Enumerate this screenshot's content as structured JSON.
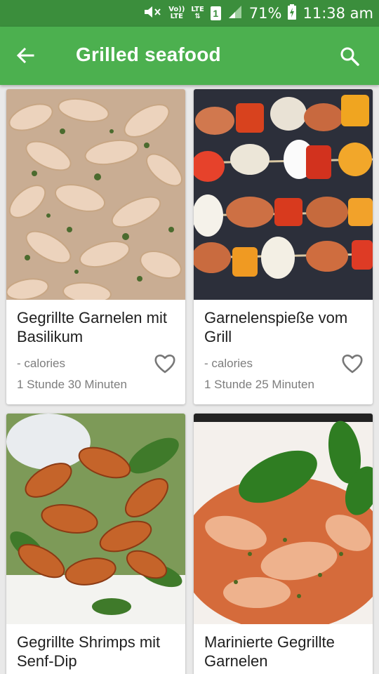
{
  "status_bar": {
    "volte_top": "Vo))",
    "volte_bottom": "LTE",
    "lte_top": "LTE",
    "lte_bottom": "⇅",
    "sim_number": "1",
    "battery_percent": "71%",
    "time": "11:38 am",
    "icons": [
      "mute-icon",
      "volte-icon",
      "lte-icon",
      "sim-icon",
      "signal-icon",
      "battery-charging-icon"
    ]
  },
  "app_bar": {
    "title": "Grilled seafood",
    "back_icon": "arrow-back-icon",
    "search_icon": "search-icon",
    "color": "#4cb04f",
    "status_color": "#3b8e3c"
  },
  "recipes": [
    {
      "name": "Gegrillte Garnelen mit Basilikum",
      "calories": "- calories",
      "duration": "1 Stunde 30 Minuten",
      "favorite_icon": "heart-outline-icon"
    },
    {
      "name": "Garnelenspieße vom Grill",
      "calories": "- calories",
      "duration": "1 Stunde 25 Minuten",
      "favorite_icon": "heart-outline-icon"
    },
    {
      "name": "Gegrillte Shrimps mit Senf-Dip",
      "calories": "",
      "duration": "",
      "favorite_icon": "heart-outline-icon"
    },
    {
      "name": "Marinierte Gegrillte Garnelen",
      "calories": "",
      "duration": "",
      "favorite_icon": "heart-outline-icon"
    }
  ]
}
